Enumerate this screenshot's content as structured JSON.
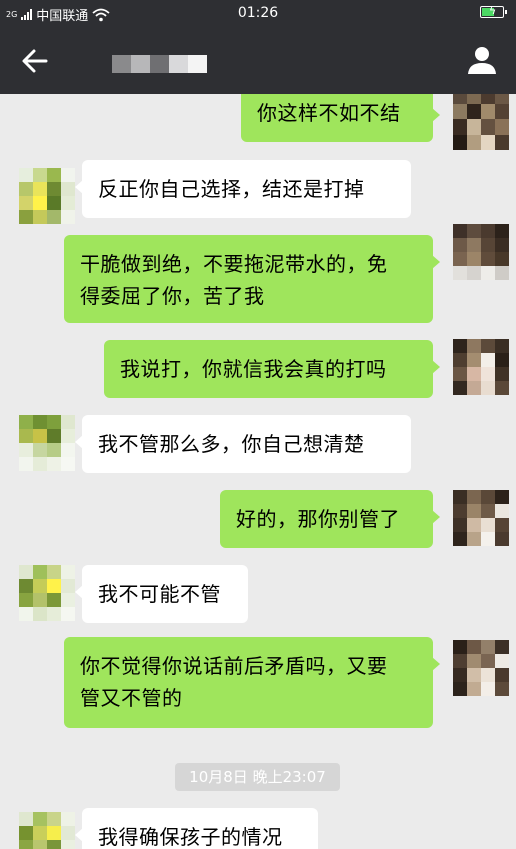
{
  "status_bar": {
    "carrier": "中国联通",
    "network_label": "2G",
    "time": "01:26"
  },
  "header": {
    "back_icon": "back-arrow-icon",
    "profile_icon": "person-icon",
    "title_obscured": true
  },
  "colors": {
    "bar": "#2e2f33",
    "chat_bg": "#ebebeb",
    "my_bubble": "#9fe55c",
    "their_bubble": "#ffffff"
  },
  "messages": [
    {
      "side": "me",
      "text": "你这样不如不结"
    },
    {
      "side": "them",
      "text": "反正你自己选择，结还是打掉"
    },
    {
      "side": "me",
      "text": "干脆做到绝，不要拖泥带水的，免\n得委屈了你，苦了我"
    },
    {
      "side": "me",
      "text": "我说打，你就信我会真的打吗"
    },
    {
      "side": "them",
      "text": "我不管那么多，你自己想清楚"
    },
    {
      "side": "me",
      "text": "好的，那你别管了"
    },
    {
      "side": "them",
      "text": "我不可能不管"
    },
    {
      "side": "me",
      "text": "你不觉得你说话前后矛盾吗，又要\n管又不管的"
    },
    {
      "side": "them",
      "text": "我得确保孩子的情况"
    }
  ],
  "timestamp": "10月8日 晚上23:07"
}
